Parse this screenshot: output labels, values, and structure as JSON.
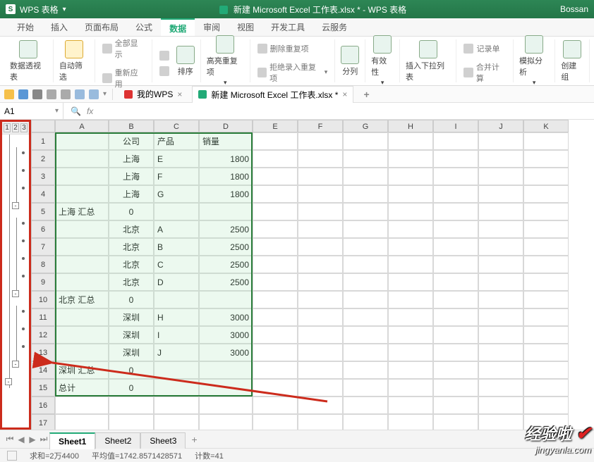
{
  "app": {
    "name": "WPS 表格",
    "title_icon": "S",
    "doc_title": "新建 Microsoft Excel 工作表.xlsx * - WPS 表格",
    "user": "Bossan"
  },
  "menus": [
    "开始",
    "插入",
    "页面布局",
    "公式",
    "数据",
    "审阅",
    "视图",
    "开发工具",
    "云服务"
  ],
  "menu_active": 4,
  "ribbon": {
    "pivot": "数据透视表",
    "autofilter": "自动筛选",
    "showall": "全部显示",
    "reapply": "重新应用",
    "sort": "排序",
    "highlight": "高亮重复项",
    "deldup": "删除重复项",
    "rejectdup": "拒绝录入重复项",
    "texttocol": "分列",
    "validation": "有效性",
    "dropdown": "插入下拉列表",
    "recordform": "记录单",
    "consolidate": "合并计算",
    "whatif": "模拟分析",
    "creategroup": "创建组"
  },
  "doctabs": {
    "wps": "我的WPS",
    "file": "新建 Microsoft Excel 工作表.xlsx *"
  },
  "namebox": "A1",
  "fx_label": "fx",
  "outline_levels": [
    "1",
    "2",
    "3"
  ],
  "columns": [
    "A",
    "B",
    "C",
    "D",
    "E",
    "F",
    "G",
    "H",
    "I",
    "J",
    "K"
  ],
  "headers": {
    "company": "公司",
    "product": "产品",
    "sales": "销量"
  },
  "rows": [
    {
      "n": "1",
      "a": "",
      "b": "公司",
      "c": "产品",
      "d": "销量",
      "b_center": true
    },
    {
      "n": "2",
      "a": "",
      "b": "上海",
      "c": "E",
      "d": "1800",
      "b_center": true,
      "d_right": true
    },
    {
      "n": "3",
      "a": "",
      "b": "上海",
      "c": "F",
      "d": "1800",
      "b_center": true,
      "d_right": true
    },
    {
      "n": "4",
      "a": "",
      "b": "上海",
      "c": "G",
      "d": "1800",
      "b_center": true,
      "d_right": true
    },
    {
      "n": "5",
      "a": "上海 汇总",
      "b": "0",
      "c": "",
      "d": "",
      "b_center": true
    },
    {
      "n": "6",
      "a": "",
      "b": "北京",
      "c": "A",
      "d": "2500",
      "b_center": true,
      "d_right": true
    },
    {
      "n": "7",
      "a": "",
      "b": "北京",
      "c": "B",
      "d": "2500",
      "b_center": true,
      "d_right": true
    },
    {
      "n": "8",
      "a": "",
      "b": "北京",
      "c": "C",
      "d": "2500",
      "b_center": true,
      "d_right": true
    },
    {
      "n": "9",
      "a": "",
      "b": "北京",
      "c": "D",
      "d": "2500",
      "b_center": true,
      "d_right": true
    },
    {
      "n": "10",
      "a": "北京 汇总",
      "b": "0",
      "c": "",
      "d": "",
      "b_center": true
    },
    {
      "n": "11",
      "a": "",
      "b": "深圳",
      "c": "H",
      "d": "3000",
      "b_center": true,
      "d_right": true
    },
    {
      "n": "12",
      "a": "",
      "b": "深圳",
      "c": "I",
      "d": "3000",
      "b_center": true,
      "d_right": true
    },
    {
      "n": "13",
      "a": "",
      "b": "深圳",
      "c": "J",
      "d": "3000",
      "b_center": true,
      "d_right": true
    },
    {
      "n": "14",
      "a": "深圳 汇总",
      "b": "0",
      "c": "",
      "d": "",
      "b_center": true
    },
    {
      "n": "15",
      "a": "总计",
      "b": "0",
      "c": "",
      "d": "",
      "b_center": true
    },
    {
      "n": "16",
      "a": "",
      "b": "",
      "c": "",
      "d": ""
    },
    {
      "n": "17",
      "a": "",
      "b": "",
      "c": "",
      "d": ""
    }
  ],
  "sheets": [
    "Sheet1",
    "Sheet2",
    "Sheet3"
  ],
  "sheet_active": 0,
  "status": {
    "sum": "求和=2万4400",
    "avg": "平均值=1742.8571428571",
    "count": "计数=41"
  },
  "watermark": {
    "brand": "经验啦",
    "site": "jingyanla.com"
  }
}
